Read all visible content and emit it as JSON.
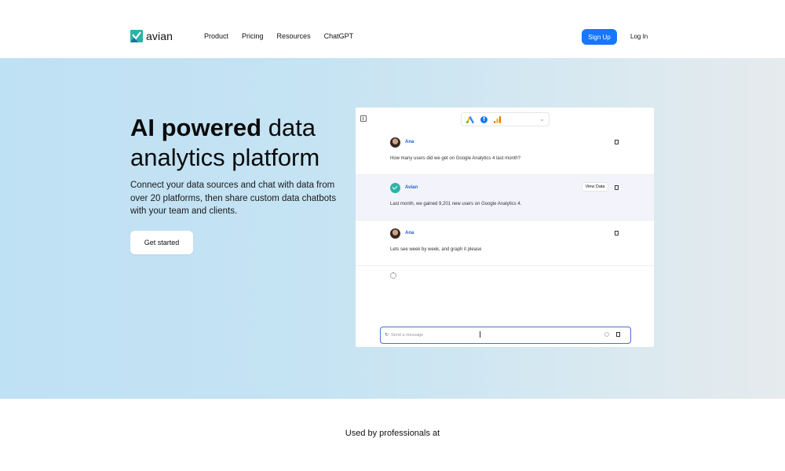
{
  "header": {
    "brand": "avian",
    "nav": [
      "Product",
      "Pricing",
      "Resources",
      "ChatGPT"
    ],
    "signup_label": "Sign Up",
    "login_label": "Log In",
    "accent": "#1677ff"
  },
  "hero": {
    "title_bold": "AI powered",
    "title_rest_line1": " data",
    "title_line2": "analytics platform",
    "subtitle": "Connect your data sources and chat with data from over 20 platforms, then share custom data chatbots with your team and clients.",
    "cta_label": "Get started"
  },
  "chat": {
    "sources": [
      "google-ads-icon",
      "facebook-icon",
      "google-analytics-icon"
    ],
    "messages": [
      {
        "sender": "Ana",
        "type": "user",
        "text": "How many users did we get on Google Analytics 4 last month?"
      },
      {
        "sender": "Avian",
        "type": "ai",
        "text": "Last month, we gained 9,201 new users on Google Analytics 4.",
        "action_label": "View Data"
      },
      {
        "sender": "Ana",
        "type": "user",
        "text": "Lets see week by week, and graph it please"
      }
    ],
    "input_placeholder": "Send a message"
  },
  "logos_section": {
    "heading": "Used by professionals at"
  }
}
